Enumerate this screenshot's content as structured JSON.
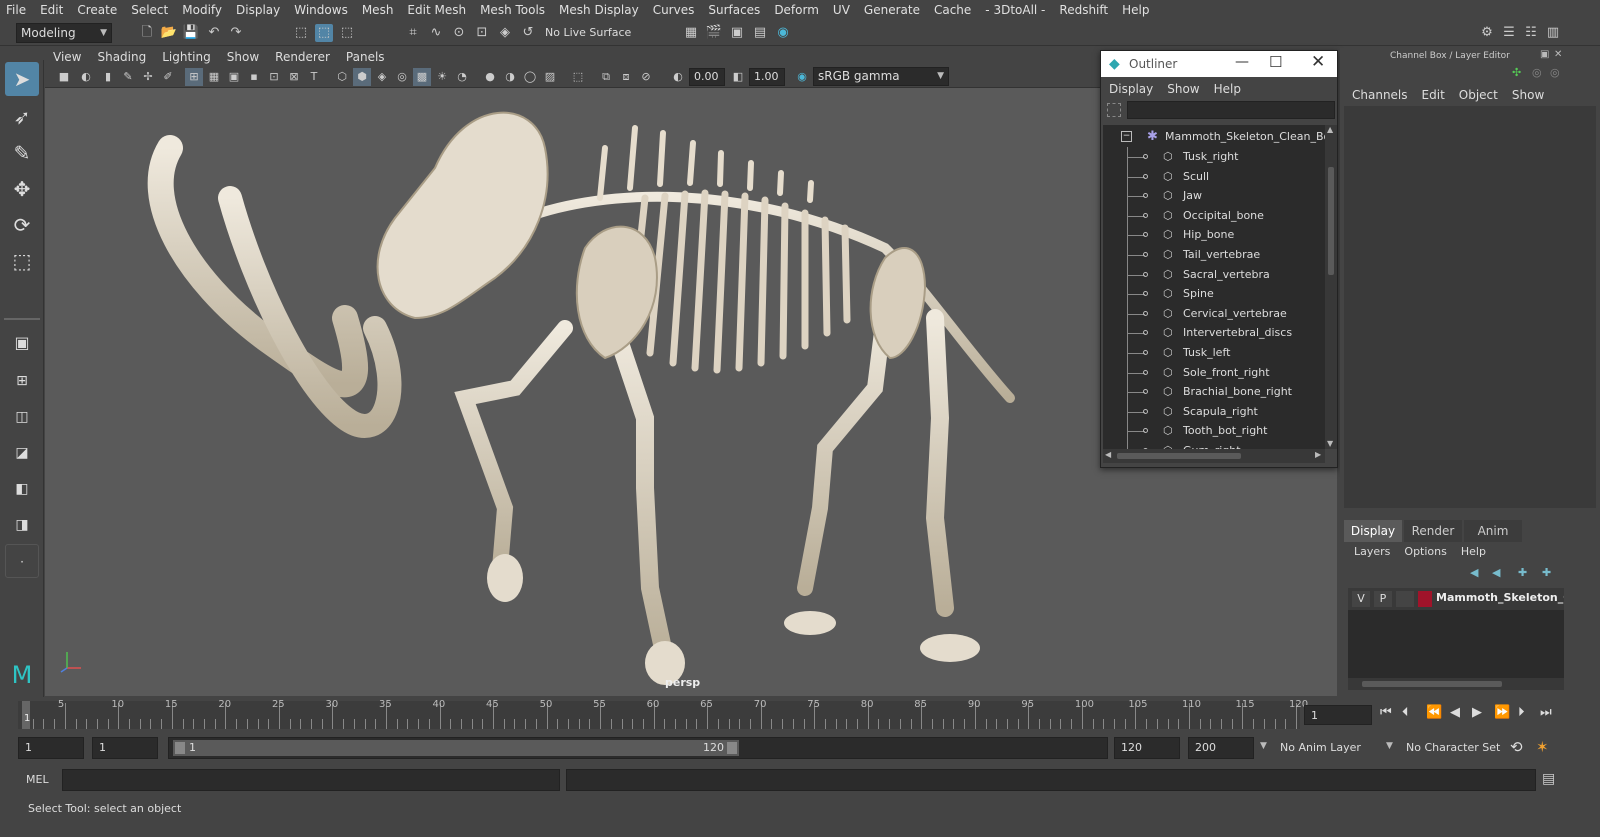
{
  "menubar": {
    "items": [
      "File",
      "Edit",
      "Create",
      "Select",
      "Modify",
      "Display",
      "Windows",
      "Mesh",
      "Edit Mesh",
      "Mesh Tools",
      "Mesh Display",
      "Curves",
      "Surfaces",
      "Deform",
      "UV",
      "Generate",
      "Cache",
      "- 3DtoAll -",
      "Redshift",
      "Help"
    ]
  },
  "shelf": {
    "mode_dropdown": "Modeling",
    "live_surface": "No Live Surface"
  },
  "viewport": {
    "menu": [
      "View",
      "Shading",
      "Lighting",
      "Show",
      "Renderer",
      "Panels"
    ],
    "exposure": "0.00",
    "gamma": "1.00",
    "color_space": "sRGB gamma",
    "camera_label": "persp"
  },
  "outliner": {
    "title": "Outliner",
    "menu": [
      "Display",
      "Show",
      "Help"
    ],
    "root": "Mammoth_Skeleton_Clean_Bon",
    "items": [
      "Tusk_right",
      "Scull",
      "Jaw",
      "Occipital_bone",
      "Hip_bone",
      "Tail_vertebrae",
      "Sacral_vertebra",
      "Spine",
      "Cervical_vertebrae",
      "Intervertebral_discs",
      "Tusk_left",
      "Sole_front_right",
      "Brachial_bone_right",
      "Scapula_right",
      "Tooth_bot_right",
      "Gum_right"
    ]
  },
  "channelbox": {
    "title": "Channel Box / Layer Editor",
    "menu": [
      "Channels",
      "Edit",
      "Object",
      "Show"
    ],
    "tabs": [
      "Display",
      "Render",
      "Anim"
    ],
    "layer_menu": [
      "Layers",
      "Options",
      "Help"
    ],
    "layer_v": "V",
    "layer_p": "P",
    "layer_name": "Mammoth_Skeleton_Clea",
    "layer_color": "#a0132a"
  },
  "timeline": {
    "ticks": [
      "5",
      "10",
      "15",
      "20",
      "25",
      "30",
      "35",
      "40",
      "45",
      "50",
      "55",
      "60",
      "65",
      "70",
      "75",
      "80",
      "85",
      "90",
      "95",
      "100",
      "105",
      "110",
      "115",
      "120"
    ],
    "current_marker": "1",
    "current_frame": "1"
  },
  "range": {
    "start": "1",
    "playback_start": "1",
    "slider_start": "1",
    "slider_end": "120",
    "playback_end": "120",
    "end": "200",
    "anim_layer": "No Anim Layer",
    "character_set": "No Character Set"
  },
  "cmdline": {
    "label": "MEL"
  },
  "helpline": {
    "text": "Select Tool: select an object"
  },
  "colors": {
    "accent": "#5285a6",
    "background": "#444444",
    "viewport": "#5a5a5a"
  }
}
